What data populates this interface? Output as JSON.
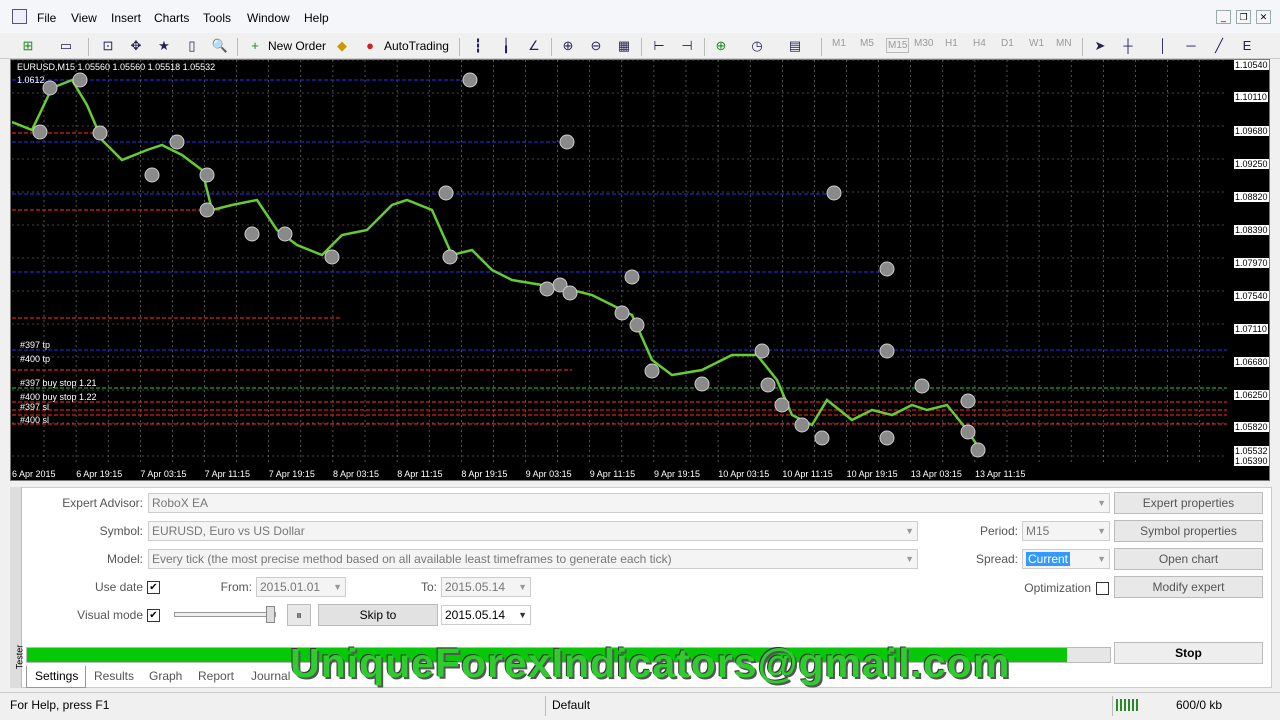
{
  "menu": [
    "File",
    "Edit",
    "View",
    "Insert",
    "Charts",
    "Tools",
    "Window",
    "Help"
  ],
  "toolbar": {
    "new_order": "New Order",
    "autotrading": "AutoTrading",
    "timeframes": [
      "M1",
      "M5",
      "M15",
      "M30",
      "H1",
      "H4",
      "D1",
      "W1",
      "MN"
    ]
  },
  "chart": {
    "header": "EURUSD,M15  1.05560 1.05560 1.05518 1.05532",
    "top_left_price": "1.0612",
    "price_labels": [
      "1.10540",
      "1.10110",
      "1.09680",
      "1.09250",
      "1.08820",
      "1.08390",
      "1.07970",
      "1.07540",
      "1.07110",
      "1.06680",
      "1.06250",
      "1.05820",
      "1.05532",
      "1.05390"
    ],
    "time_labels": [
      "6 Apr 2015",
      "6 Apr 19:15",
      "7 Apr 03:15",
      "7 Apr 11:15",
      "7 Apr 19:15",
      "8 Apr 03:15",
      "8 Apr 11:15",
      "8 Apr 19:15",
      "9 Apr 03:15",
      "9 Apr 11:15",
      "9 Apr 19:15",
      "10 Apr 03:15",
      "10 Apr 11:15",
      "10 Apr 19:15",
      "13 Apr 03:15",
      "13 Apr 11:15"
    ],
    "order_labels": [
      "#397 tp",
      "#400 tp",
      "#397 buy stop 1.21",
      "#400 buy stop 1.22",
      "#397 sl",
      "#400 sl"
    ],
    "colors": {
      "candle": "#66cc33",
      "buy_line": "#2323c8",
      "sell_line": "#d12020",
      "grid": "#888888"
    }
  },
  "tester": {
    "expert_label": "Expert Advisor:",
    "expert_value": "RoboX EA",
    "symbol_label": "Symbol:",
    "symbol_value": "EURUSD, Euro vs US Dollar",
    "model_label": "Model:",
    "model_value": "Every tick (the most precise method based on all available least timeframes to generate each tick)",
    "use_date_label": "Use date",
    "from_label": "From:",
    "from_value": "2015.01.01",
    "to_label": "To:",
    "to_value": "2015.05.14",
    "visual_label": "Visual mode",
    "skip_to_label": "Skip to",
    "skip_value": "2015.05.14",
    "period_label": "Period:",
    "period_value": "M15",
    "spread_label": "Spread:",
    "spread_value": "Current",
    "optimization_label": "Optimization",
    "expert_properties": "Expert properties",
    "symbol_properties": "Symbol properties",
    "open_chart": "Open chart",
    "modify_expert": "Modify expert",
    "stop": "Stop",
    "progress": 0.96,
    "tabs": [
      "Settings",
      "Results",
      "Graph",
      "Report",
      "Journal"
    ],
    "side_label": "Tester"
  },
  "watermark": "UniqueForexIndicators@gmail.com",
  "status": {
    "help": "For Help, press F1",
    "profile": "Default",
    "traffic": "600/0 kb"
  }
}
